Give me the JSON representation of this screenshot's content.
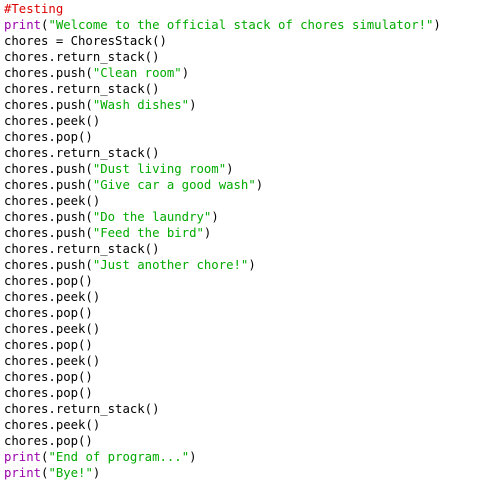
{
  "editor": {
    "colors": {
      "comment": "#dd0000",
      "keyword": "#9900aa",
      "string": "#00aa00",
      "plain": "#000000",
      "background": "#ffffff"
    },
    "lines": [
      [
        {
          "t": "comment",
          "v": "#Testing"
        }
      ],
      [
        {
          "t": "keyword",
          "v": "print"
        },
        {
          "t": "plain",
          "v": "("
        },
        {
          "t": "string",
          "v": "\"Welcome to the official stack of chores simulator!\""
        },
        {
          "t": "plain",
          "v": ")"
        }
      ],
      [
        {
          "t": "plain",
          "v": "chores = ChoresStack()"
        }
      ],
      [
        {
          "t": "plain",
          "v": "chores.return_stack()"
        }
      ],
      [
        {
          "t": "plain",
          "v": "chores.push("
        },
        {
          "t": "string",
          "v": "\"Clean room\""
        },
        {
          "t": "plain",
          "v": ")"
        }
      ],
      [
        {
          "t": "plain",
          "v": "chores.return_stack()"
        }
      ],
      [
        {
          "t": "plain",
          "v": "chores.push("
        },
        {
          "t": "string",
          "v": "\"Wash dishes\""
        },
        {
          "t": "plain",
          "v": ")"
        }
      ],
      [
        {
          "t": "plain",
          "v": "chores.peek()"
        }
      ],
      [
        {
          "t": "plain",
          "v": "chores.pop()"
        }
      ],
      [
        {
          "t": "plain",
          "v": "chores.return_stack()"
        }
      ],
      [
        {
          "t": "plain",
          "v": "chores.push("
        },
        {
          "t": "string",
          "v": "\"Dust living room\""
        },
        {
          "t": "plain",
          "v": ")"
        }
      ],
      [
        {
          "t": "plain",
          "v": "chores.push("
        },
        {
          "t": "string",
          "v": "\"Give car a good wash\""
        },
        {
          "t": "plain",
          "v": ")"
        }
      ],
      [
        {
          "t": "plain",
          "v": "chores.peek()"
        }
      ],
      [
        {
          "t": "plain",
          "v": "chores.push("
        },
        {
          "t": "string",
          "v": "\"Do the laundry\""
        },
        {
          "t": "plain",
          "v": ")"
        }
      ],
      [
        {
          "t": "plain",
          "v": "chores.push("
        },
        {
          "t": "string",
          "v": "\"Feed the bird\""
        },
        {
          "t": "plain",
          "v": ")"
        }
      ],
      [
        {
          "t": "plain",
          "v": "chores.return_stack()"
        }
      ],
      [
        {
          "t": "plain",
          "v": "chores.push("
        },
        {
          "t": "string",
          "v": "\"Just another chore!\""
        },
        {
          "t": "plain",
          "v": ")"
        }
      ],
      [
        {
          "t": "plain",
          "v": "chores.pop()"
        }
      ],
      [
        {
          "t": "plain",
          "v": "chores.peek()"
        }
      ],
      [
        {
          "t": "plain",
          "v": "chores.pop()"
        }
      ],
      [
        {
          "t": "plain",
          "v": "chores.peek()"
        }
      ],
      [
        {
          "t": "plain",
          "v": "chores.pop()"
        }
      ],
      [
        {
          "t": "plain",
          "v": "chores.peek()"
        }
      ],
      [
        {
          "t": "plain",
          "v": "chores.pop()"
        }
      ],
      [
        {
          "t": "plain",
          "v": "chores.pop()"
        }
      ],
      [
        {
          "t": "plain",
          "v": "chores.return_stack()"
        }
      ],
      [
        {
          "t": "plain",
          "v": "chores.peek()"
        }
      ],
      [
        {
          "t": "plain",
          "v": "chores.pop()"
        }
      ],
      [
        {
          "t": "keyword",
          "v": "print"
        },
        {
          "t": "plain",
          "v": "("
        },
        {
          "t": "string",
          "v": "\"End of program...\""
        },
        {
          "t": "plain",
          "v": ")"
        }
      ],
      [
        {
          "t": "keyword",
          "v": "print"
        },
        {
          "t": "plain",
          "v": "("
        },
        {
          "t": "string",
          "v": "\"Bye!\""
        },
        {
          "t": "plain",
          "v": ")"
        }
      ]
    ]
  }
}
